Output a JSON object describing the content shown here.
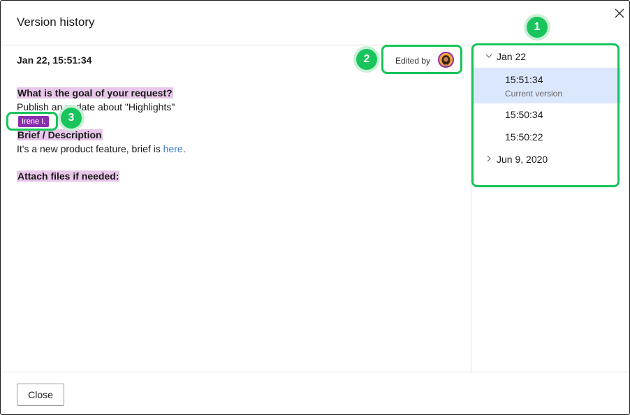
{
  "dialog": {
    "title": "Version history",
    "close_icon": "close-icon"
  },
  "document": {
    "version_time": "Jan 22, 15:51:34",
    "edited_by_label": "Edited by",
    "avatar_icon": "user-avatar",
    "q1": "What is the goal of your request?",
    "a1_pre": "Publish an update about \"Highlights\"",
    "cursor_user": "Irene I.",
    "q2": "Brief / Description",
    "a2_pre": "It's a new product feature, brief is ",
    "a2_link": "here",
    "a2_post": ".",
    "q3": "Attach files if needed:",
    "highlight_color": "#e8c7ea",
    "cursor_color": "#8b2fb0",
    "link_color": "#3a7bd5"
  },
  "sidebar": {
    "groups": [
      {
        "label": "Jan 22",
        "expanded": true,
        "versions": [
          {
            "time": "15:51:34",
            "note": "Current version",
            "active": true
          },
          {
            "time": "15:50:34",
            "note": "",
            "active": false
          },
          {
            "time": "15:50:22",
            "note": "",
            "active": false
          }
        ]
      },
      {
        "label": "Jun 9, 2020",
        "expanded": false,
        "versions": []
      }
    ],
    "active_color": "#dbe7fc"
  },
  "footer": {
    "close_label": "Close"
  },
  "annotations": {
    "color": "#18c45b",
    "badges": [
      "1",
      "2",
      "3"
    ]
  }
}
